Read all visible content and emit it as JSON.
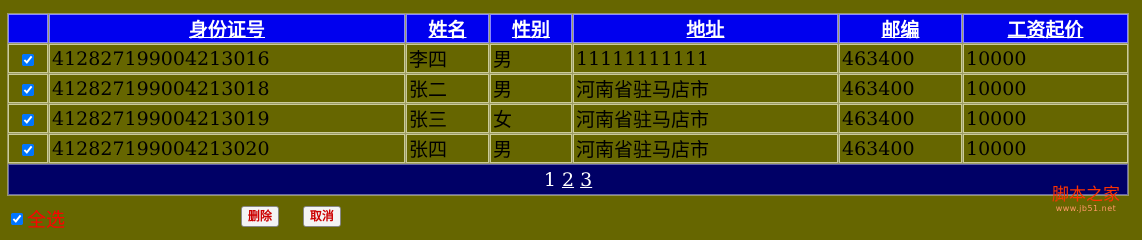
{
  "table": {
    "columns": [
      "身份证号",
      "姓名",
      "性别",
      "地址",
      "邮编",
      "工资起价"
    ],
    "rows": [
      {
        "id": "412827199004213016",
        "name": "李四",
        "gender": "男",
        "address": "11111111111",
        "zip": "463400",
        "salary": "10000",
        "checked": true
      },
      {
        "id": "412827199004213018",
        "name": "张二",
        "gender": "男",
        "address": "河南省驻马店市",
        "zip": "463400",
        "salary": "10000",
        "checked": true
      },
      {
        "id": "412827199004213019",
        "name": "张三",
        "gender": "女",
        "address": "河南省驻马店市",
        "zip": "463400",
        "salary": "10000",
        "checked": true
      },
      {
        "id": "412827199004213020",
        "name": "张四",
        "gender": "男",
        "address": "河南省驻马店市",
        "zip": "463400",
        "salary": "10000",
        "checked": true
      }
    ]
  },
  "pager": {
    "current": "1",
    "links": [
      "2",
      "3"
    ]
  },
  "footer": {
    "select_all_label": "全选",
    "select_all_checked": true,
    "delete_label": "删除",
    "cancel_label": "取消"
  },
  "watermark": {
    "title": "脚本之家",
    "url": "www.jb51.net"
  },
  "colors": {
    "page_bg": "#666600",
    "header_bg": "#0000ee",
    "pager_bg": "#000066",
    "select_all_text": "#ff0000",
    "watermark_text": "#ff3300"
  }
}
